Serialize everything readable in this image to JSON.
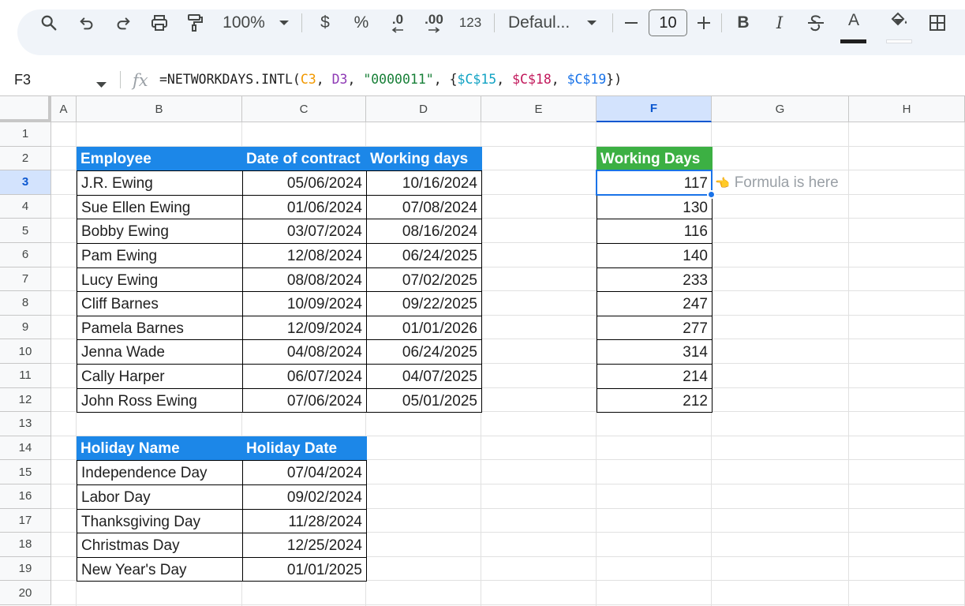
{
  "toolbar": {
    "zoom": "100%",
    "currency": "$",
    "percent": "%",
    "decrease_decimal": ".0",
    "increase_decimal": ".00",
    "number_format": "123",
    "font_name": "Defaul...",
    "font_size": "10",
    "bold": "B",
    "italic": "I",
    "text_color": "A"
  },
  "formula_bar": {
    "cell_ref": "F3",
    "fx": "fx",
    "formula_parts": [
      {
        "text": "=NETWORKDAYS.INTL(",
        "color": "#1f1f1f"
      },
      {
        "text": "C3",
        "color": "#f29900"
      },
      {
        "text": ", ",
        "color": "#1f1f1f"
      },
      {
        "text": "D3",
        "color": "#8e3ab5"
      },
      {
        "text": ", ",
        "color": "#1f1f1f"
      },
      {
        "text": "\"0000011\"",
        "color": "#188038"
      },
      {
        "text": ", {",
        "color": "#1f1f1f"
      },
      {
        "text": "$C$15",
        "color": "#12a3c4"
      },
      {
        "text": ", ",
        "color": "#1f1f1f"
      },
      {
        "text": "$C$18",
        "color": "#c2185b"
      },
      {
        "text": ", ",
        "color": "#1f1f1f"
      },
      {
        "text": "$C$19",
        "color": "#1a73e8"
      },
      {
        "text": "})",
        "color": "#1f1f1f"
      }
    ]
  },
  "columns": [
    "A",
    "B",
    "C",
    "D",
    "E",
    "F",
    "G",
    "H"
  ],
  "selected_column": "F",
  "rows": [
    "1",
    "2",
    "3",
    "4",
    "5",
    "6",
    "7",
    "8",
    "9",
    "10",
    "11",
    "12",
    "13",
    "14",
    "15",
    "16",
    "17",
    "18",
    "19",
    "20"
  ],
  "selected_row": "3",
  "employees_table": {
    "headers": [
      "Employee",
      "Date of contract",
      "Working days"
    ],
    "rows": [
      [
        "J.R. Ewing",
        "05/06/2024",
        "10/16/2024"
      ],
      [
        "Sue Ellen Ewing",
        "01/06/2024",
        "07/08/2024"
      ],
      [
        "Bobby Ewing",
        "03/07/2024",
        "08/16/2024"
      ],
      [
        "Pam Ewing",
        "12/08/2024",
        "06/24/2025"
      ],
      [
        "Lucy Ewing",
        "08/08/2024",
        "07/02/2025"
      ],
      [
        "Cliff Barnes",
        "10/09/2024",
        "09/22/2025"
      ],
      [
        "Pamela Barnes",
        "12/09/2024",
        "01/01/2026"
      ],
      [
        "Jenna Wade",
        "04/08/2024",
        "06/24/2025"
      ],
      [
        "Cally Harper",
        "06/07/2024",
        "04/07/2025"
      ],
      [
        "John Ross Ewing",
        "07/06/2024",
        "05/01/2025"
      ]
    ]
  },
  "holidays_table": {
    "headers": [
      "Holiday Name",
      "Holiday Date"
    ],
    "rows": [
      [
        "Independence Day",
        "07/04/2024"
      ],
      [
        "Labor Day",
        "09/02/2024"
      ],
      [
        "Thanksgiving Day",
        "11/28/2024"
      ],
      [
        "Christmas Day",
        "12/25/2024"
      ],
      [
        "New Year's Day",
        "01/01/2025"
      ]
    ]
  },
  "result_table": {
    "header": "Working Days",
    "values": [
      "117",
      "130",
      "116",
      "140",
      "233",
      "247",
      "277",
      "314",
      "214",
      "212"
    ]
  },
  "annotation": {
    "icon": "👈",
    "text": "Formula is here"
  },
  "colors": {
    "header_blue": "#1c87e8",
    "header_green": "#3cb043",
    "selection": "#1a73e8"
  }
}
